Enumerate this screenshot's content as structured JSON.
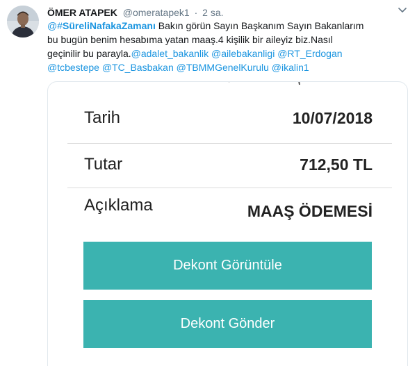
{
  "tweet": {
    "author": {
      "display_name": "ÖMER ATAPEK",
      "handle": "@omeratapek1",
      "avatar_icon": "profile-photo"
    },
    "separator": "·",
    "time": "2 sa.",
    "menu_icon": "chevron-down-icon",
    "text": {
      "mention_prefix": "@",
      "hashtag_symbol": "#",
      "hashtag_word": "SüreliNafakaZamanı",
      "body": " Bakın görün Sayın Başkanım Sayın Bakanlarım bu bugün benim hesabıma yatan maaş.4 kişilik bir aileyiz biz.Nasıl geçinilir bu parayla.",
      "mentions": [
        "@adalet_bakanlik",
        "@ailebakanligi",
        "@RT_Erdogan",
        "@tcbestepe",
        "@TC_Basbakan",
        "@TBMMGenelKurulu",
        "@ikalin1"
      ]
    },
    "colors": {
      "link": "#1b95e0",
      "button": "#3bb3b0",
      "muted": "#657786"
    }
  },
  "receipt": {
    "rows": [
      {
        "label": "Tarih",
        "value": "10/07/2018"
      },
      {
        "label": "Tutar",
        "value": "712,50 TL"
      },
      {
        "label": "Açıklama",
        "value": "MAAŞ ÖDEMESİ"
      }
    ],
    "buttons": [
      {
        "label": "Dekont Görüntüle"
      },
      {
        "label": "Dekont Gönder"
      }
    ]
  }
}
